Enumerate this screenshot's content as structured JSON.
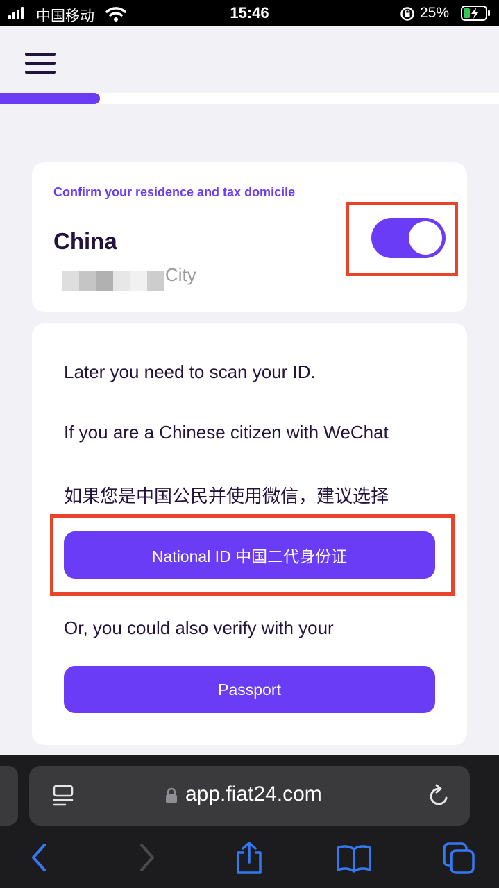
{
  "status_bar": {
    "carrier": "中国移动",
    "time": "15:46",
    "battery_percent": "25%"
  },
  "header": {
    "menu_icon": "hamburger-menu-icon"
  },
  "progress": {
    "fraction": 0.2,
    "color": "#6b3cf6"
  },
  "residence_card": {
    "label": "Confirm your residence and tax domicile",
    "country": "China",
    "city": "City",
    "toggle_on": true
  },
  "id_card": {
    "line1": "Later you need to scan your ID.",
    "line2": "If you are a Chinese citizen with WeChat",
    "line3": "如果您是中国公民并使用微信，建议选择",
    "national_id_button": "National ID 中国二代身份证",
    "line4": "Or, you could also verify with your",
    "passport_button": "Passport"
  },
  "browser": {
    "url": "app.fiat24.com"
  },
  "colors": {
    "accent": "#6b3cf6",
    "text_dark": "#22143d",
    "highlight_red": "#e8432b",
    "background": "#f2f2f6"
  }
}
